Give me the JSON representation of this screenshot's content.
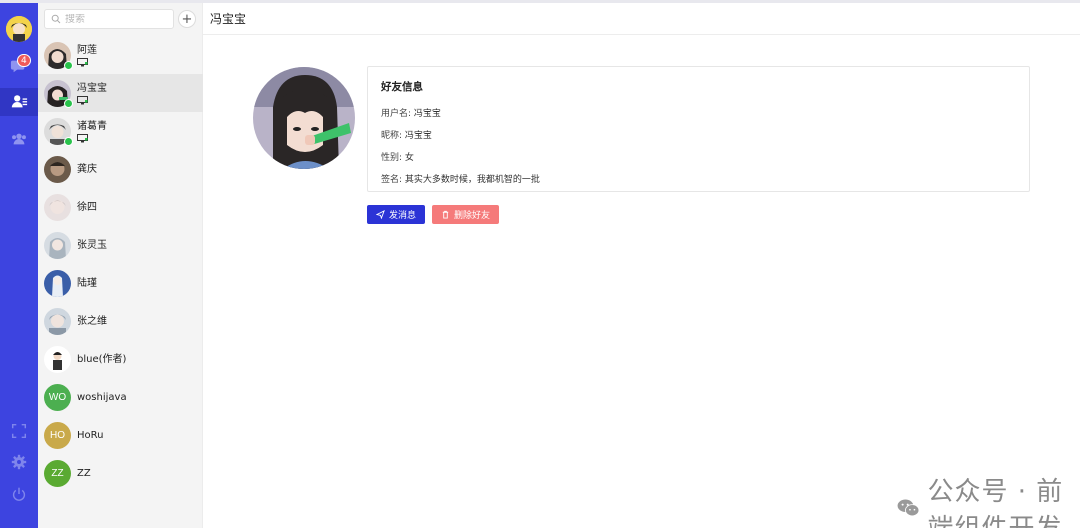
{
  "nav": {
    "unread_badge": "4",
    "accent": "#3d44e0"
  },
  "search": {
    "placeholder": "搜索"
  },
  "add_label": "+",
  "contacts": [
    {
      "name": "阿莲",
      "online": true,
      "device": true
    },
    {
      "name": "冯宝宝",
      "online": true,
      "device": true,
      "active": true
    },
    {
      "name": "诸葛青",
      "online": true,
      "device": true
    },
    {
      "name": "龚庆"
    },
    {
      "name": "徐四"
    },
    {
      "name": "张灵玉"
    },
    {
      "name": "陆瑾"
    },
    {
      "name": "张之维"
    },
    {
      "name": "blue(作者)"
    },
    {
      "name": "woshijava",
      "initials": "WO",
      "color": "#4caf50"
    },
    {
      "name": "HoRu",
      "initials": "HO",
      "color": "#c9a94a"
    },
    {
      "name": "ZZ",
      "initials": "ZZ",
      "color": "#5aaa32"
    }
  ],
  "main": {
    "title": "冯宝宝",
    "card_title": "好友信息",
    "fields": {
      "username_label": "用户名:",
      "username": "冯宝宝",
      "nickname_label": "昵称:",
      "nickname": "冯宝宝",
      "gender_label": "性别:",
      "gender": "女",
      "signature_label": "签名:",
      "signature": "其实大多数时候，我都机智的一批"
    },
    "send_label": "发消息",
    "delete_label": "删除好友"
  },
  "watermark": "公众号 · 前端组件开发"
}
